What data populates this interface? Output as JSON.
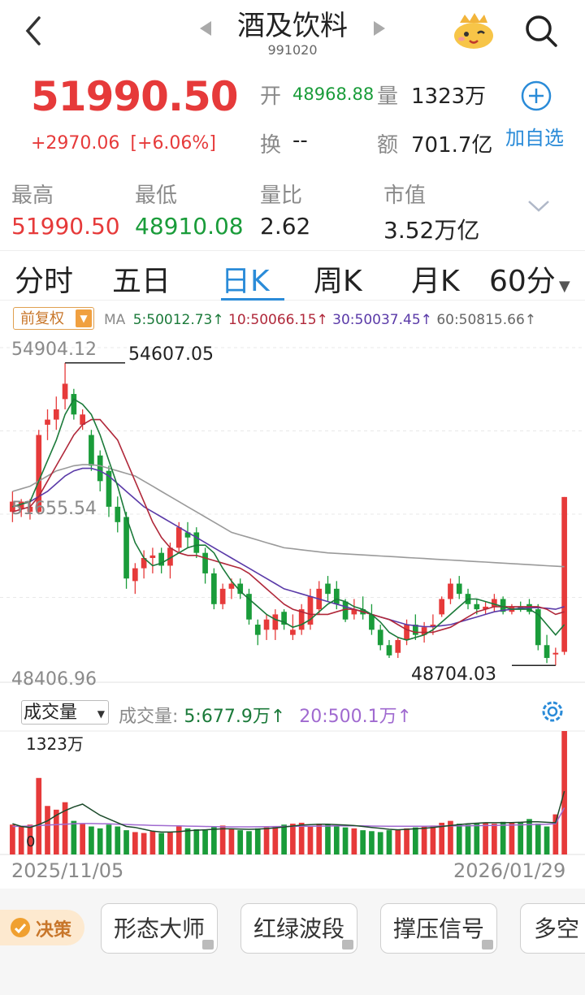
{
  "header": {
    "back_icon": "chevron-left-icon",
    "title": "酒及饮料",
    "code": "991020",
    "prev_icon": "triangle-left-icon",
    "next_icon": "triangle-right-icon",
    "mascot_icon": "mascot-icon",
    "search_icon": "search-icon"
  },
  "quote": {
    "price": "51990.50",
    "change": "+2970.06",
    "change_pct": "[+6.06%]",
    "open_label": "开",
    "open_value": "48968.88",
    "volume_label": "量",
    "volume_value": "1323万",
    "turnover_label": "换",
    "turnover_value": "--",
    "amount_label": "额",
    "amount_value": "701.7亿",
    "add_label": "加自选"
  },
  "stats": {
    "high_label": "最高",
    "high_value": "51990.50",
    "low_label": "最低",
    "low_value": "48910.08",
    "ratio_label": "量比",
    "ratio_value": "2.62",
    "cap_label": "市值",
    "cap_value": "3.52万亿"
  },
  "tabs": [
    "分时",
    "五日",
    "日K",
    "周K",
    "月K",
    "60分"
  ],
  "active_tab": "日K",
  "ma": {
    "fq_label": "前复权",
    "ma_label": "MA",
    "ma5": "5:50012.73",
    "ma10": "10:50066.15",
    "ma30": "30:50037.45",
    "ma60": "60:50815.66"
  },
  "colors": {
    "up": "#e63a3a",
    "down": "#1a9c3a",
    "ma5": "#1b7a3a",
    "ma10": "#b0283a",
    "ma30": "#5a3aa8",
    "ma60": "#9a9a9a",
    "accent": "#2a8bd8"
  },
  "chart_labels": {
    "top": "54904.12",
    "mid": "51655.54",
    "bottom": "48406.96",
    "max_marker": "54607.05",
    "min_marker": "48704.03",
    "date_start": "2025/11/05",
    "date_end": "2026/01/29"
  },
  "volume": {
    "select_label": "成交量",
    "label": "成交量:",
    "ma5": "5:677.9万",
    "ma20": "20:500.1万",
    "max_label": "1323万",
    "zero_label": "0",
    "settings_icon": "gear-icon"
  },
  "bottom_bar": {
    "decision_label": "决策",
    "buttons": [
      "形态大师",
      "红绿波段",
      "撑压信号",
      "多空"
    ]
  },
  "chart_data": {
    "type": "candlestick",
    "ylim": [
      48406.96,
      54904.12
    ],
    "candles": [
      {
        "o": 51900,
        "h": 52100,
        "l": 51500,
        "c": 51700,
        "up": true
      },
      {
        "o": 51750,
        "h": 51950,
        "l": 51600,
        "c": 51900,
        "up": true
      },
      {
        "o": 51700,
        "h": 51950,
        "l": 51550,
        "c": 51800,
        "up": true
      },
      {
        "o": 51700,
        "h": 53300,
        "l": 51650,
        "c": 53200,
        "up": true
      },
      {
        "o": 53400,
        "h": 53700,
        "l": 53100,
        "c": 53500,
        "up": true
      },
      {
        "o": 53500,
        "h": 53950,
        "l": 53300,
        "c": 53700,
        "up": true
      },
      {
        "o": 53900,
        "h": 54607,
        "l": 53700,
        "c": 54200,
        "up": true
      },
      {
        "o": 54000,
        "h": 54100,
        "l": 53500,
        "c": 53600,
        "up": false
      },
      {
        "o": 53600,
        "h": 53700,
        "l": 53300,
        "c": 53400,
        "up": true
      },
      {
        "o": 53200,
        "h": 53300,
        "l": 52500,
        "c": 52600,
        "up": false
      },
      {
        "o": 52800,
        "h": 52900,
        "l": 52100,
        "c": 52300,
        "up": false
      },
      {
        "o": 52500,
        "h": 52600,
        "l": 51600,
        "c": 51800,
        "up": false
      },
      {
        "o": 51800,
        "h": 52000,
        "l": 51300,
        "c": 51500,
        "up": false
      },
      {
        "o": 51600,
        "h": 51700,
        "l": 50200,
        "c": 50400,
        "up": false
      },
      {
        "o": 50350,
        "h": 50700,
        "l": 50100,
        "c": 50600,
        "up": true
      },
      {
        "o": 50600,
        "h": 50950,
        "l": 50400,
        "c": 50800,
        "up": true
      },
      {
        "o": 50800,
        "h": 51000,
        "l": 50500,
        "c": 50850,
        "up": true
      },
      {
        "o": 50900,
        "h": 51000,
        "l": 50500,
        "c": 50650,
        "up": false
      },
      {
        "o": 50650,
        "h": 51100,
        "l": 50400,
        "c": 51000,
        "up": true
      },
      {
        "o": 51000,
        "h": 51500,
        "l": 50900,
        "c": 51400,
        "up": true
      },
      {
        "o": 51300,
        "h": 51500,
        "l": 51000,
        "c": 51200,
        "up": false
      },
      {
        "o": 51300,
        "h": 51400,
        "l": 50800,
        "c": 50900,
        "up": false
      },
      {
        "o": 50900,
        "h": 51000,
        "l": 50300,
        "c": 50500,
        "up": false
      },
      {
        "o": 50500,
        "h": 50600,
        "l": 49800,
        "c": 49900,
        "up": false
      },
      {
        "o": 49900,
        "h": 50300,
        "l": 49800,
        "c": 50200,
        "up": true
      },
      {
        "o": 50200,
        "h": 50400,
        "l": 50000,
        "c": 50300,
        "up": true
      },
      {
        "o": 50300,
        "h": 50400,
        "l": 50000,
        "c": 50100,
        "up": false
      },
      {
        "o": 50100,
        "h": 50200,
        "l": 49500,
        "c": 49600,
        "up": false
      },
      {
        "o": 49500,
        "h": 49600,
        "l": 49100,
        "c": 49300,
        "up": false
      },
      {
        "o": 49400,
        "h": 49700,
        "l": 49200,
        "c": 49600,
        "up": true
      },
      {
        "o": 49400,
        "h": 49800,
        "l": 49200,
        "c": 49700,
        "up": true
      },
      {
        "o": 49750,
        "h": 49800,
        "l": 49400,
        "c": 49500,
        "up": false
      },
      {
        "o": 49400,
        "h": 49700,
        "l": 49200,
        "c": 49300,
        "up": true
      },
      {
        "o": 49400,
        "h": 49900,
        "l": 49300,
        "c": 49800,
        "up": true
      },
      {
        "o": 49500,
        "h": 50200,
        "l": 49400,
        "c": 50050,
        "up": true
      },
      {
        "o": 49800,
        "h": 50350,
        "l": 49700,
        "c": 50200,
        "up": true
      },
      {
        "o": 50300,
        "h": 50450,
        "l": 49950,
        "c": 50100,
        "up": false
      },
      {
        "o": 50200,
        "h": 50350,
        "l": 49800,
        "c": 49900,
        "up": false
      },
      {
        "o": 49950,
        "h": 50000,
        "l": 49550,
        "c": 49600,
        "up": false
      },
      {
        "o": 49700,
        "h": 50000,
        "l": 49600,
        "c": 49800,
        "up": true
      },
      {
        "o": 49800,
        "h": 50050,
        "l": 49600,
        "c": 49700,
        "up": false
      },
      {
        "o": 49700,
        "h": 49900,
        "l": 49300,
        "c": 49400,
        "up": false
      },
      {
        "o": 49400,
        "h": 49500,
        "l": 49000,
        "c": 49100,
        "up": false
      },
      {
        "o": 49100,
        "h": 49200,
        "l": 48850,
        "c": 48900,
        "up": false
      },
      {
        "o": 48950,
        "h": 49250,
        "l": 48850,
        "c": 49200,
        "up": true
      },
      {
        "o": 49200,
        "h": 49600,
        "l": 49100,
        "c": 49500,
        "up": true
      },
      {
        "o": 49500,
        "h": 49700,
        "l": 49200,
        "c": 49300,
        "up": false
      },
      {
        "o": 49300,
        "h": 49550,
        "l": 49150,
        "c": 49450,
        "up": true
      },
      {
        "o": 49450,
        "h": 49700,
        "l": 49300,
        "c": 49500,
        "up": true
      },
      {
        "o": 49700,
        "h": 50050,
        "l": 49650,
        "c": 50000,
        "up": true
      },
      {
        "o": 50000,
        "h": 50400,
        "l": 49900,
        "c": 50300,
        "up": true
      },
      {
        "o": 50300,
        "h": 50450,
        "l": 50000,
        "c": 50100,
        "up": false
      },
      {
        "o": 50100,
        "h": 50200,
        "l": 49800,
        "c": 49900,
        "up": false
      },
      {
        "o": 49900,
        "h": 50000,
        "l": 49700,
        "c": 49800,
        "up": false
      },
      {
        "o": 49800,
        "h": 49950,
        "l": 49700,
        "c": 49850,
        "up": true
      },
      {
        "o": 49850,
        "h": 50100,
        "l": 49750,
        "c": 50000,
        "up": true
      },
      {
        "o": 50000,
        "h": 50050,
        "l": 49700,
        "c": 49750,
        "up": false
      },
      {
        "o": 49750,
        "h": 49900,
        "l": 49700,
        "c": 49850,
        "up": true
      },
      {
        "o": 49850,
        "h": 49950,
        "l": 49750,
        "c": 49800,
        "up": false
      },
      {
        "o": 49900,
        "h": 50000,
        "l": 49700,
        "c": 49750,
        "up": false
      },
      {
        "o": 49800,
        "h": 49900,
        "l": 49000,
        "c": 49100,
        "up": false
      },
      {
        "o": 49100,
        "h": 49300,
        "l": 48750,
        "c": 48850,
        "up": false
      },
      {
        "o": 48950,
        "h": 49050,
        "l": 48704,
        "c": 48950,
        "up": true
      },
      {
        "o": 48968.88,
        "h": 51990.5,
        "l": 48910.08,
        "c": 51990.5,
        "up": true
      }
    ],
    "ma5": [
      51800,
      51850,
      51900,
      52300,
      52700,
      53100,
      53600,
      53900,
      53800,
      53600,
      53200,
      52700,
      52200,
      51600,
      51100,
      50800,
      50650,
      50700,
      50800,
      50900,
      51000,
      51050,
      51050,
      50900,
      50600,
      50350,
      50150,
      50000,
      49850,
      49700,
      49600,
      49550,
      49450,
      49500,
      49600,
      49750,
      49900,
      50000,
      49950,
      49850,
      49800,
      49700,
      49550,
      49350,
      49250,
      49200,
      49250,
      49300,
      49400,
      49550,
      49700,
      49850,
      50000,
      50000,
      49950,
      49900,
      49850,
      49800,
      49800,
      49800,
      49700,
      49500,
      49300,
      49500
    ],
    "ma10": [
      51700,
      51750,
      51800,
      52000,
      52300,
      52600,
      52900,
      53200,
      53400,
      53500,
      53500,
      53300,
      53100,
      52700,
      52300,
      51900,
      51500,
      51200,
      51000,
      50900,
      50850,
      50850,
      50800,
      50750,
      50700,
      50650,
      50600,
      50500,
      50350,
      50200,
      50050,
      49900,
      49800,
      49750,
      49700,
      49700,
      49700,
      49750,
      49800,
      49800,
      49750,
      49700,
      49650,
      49600,
      49500,
      49400,
      49350,
      49350,
      49350,
      49400,
      49450,
      49550,
      49650,
      49750,
      49800,
      49850,
      49850,
      49850,
      49850,
      49850,
      49850,
      49800,
      49700,
      49750
    ],
    "ma30": [
      51800,
      51850,
      51900,
      52000,
      52100,
      52250,
      52400,
      52500,
      52550,
      52550,
      52500,
      52400,
      52250,
      52100,
      51950,
      51800,
      51700,
      51600,
      51500,
      51400,
      51300,
      51200,
      51100,
      51000,
      50900,
      50800,
      50700,
      50600,
      50500,
      50400,
      50300,
      50200,
      50150,
      50100,
      50050,
      50000,
      49950,
      49900,
      49850,
      49800,
      49750,
      49700,
      49650,
      49600,
      49550,
      49500,
      49480,
      49460,
      49460,
      49480,
      49500,
      49550,
      49600,
      49650,
      49700,
      49750,
      49780,
      49800,
      49820,
      49830,
      49830,
      49820,
      49800,
      49850
    ],
    "ma60": [
      52100,
      52150,
      52200,
      52300,
      52400,
      52500,
      52550,
      52600,
      52620,
      52620,
      52600,
      52550,
      52500,
      52450,
      52400,
      52300,
      52200,
      52100,
      52000,
      51900,
      51800,
      51700,
      51600,
      51500,
      51400,
      51300,
      51250,
      51200,
      51150,
      51100,
      51050,
      51000,
      50980,
      50960,
      50940,
      50920,
      50900,
      50890,
      50880,
      50870,
      50860,
      50850,
      50840,
      50830,
      50820,
      50810,
      50800,
      50790,
      50780,
      50770,
      50760,
      50750,
      50740,
      50730,
      50720,
      50710,
      50700,
      50690,
      50680,
      50670,
      50660,
      50650,
      50640,
      50630
    ],
    "volume": [
      320,
      300,
      320,
      820,
      520,
      480,
      560,
      360,
      330,
      300,
      280,
      320,
      300,
      260,
      240,
      230,
      250,
      230,
      240,
      300,
      280,
      270,
      260,
      300,
      310,
      270,
      260,
      250,
      280,
      290,
      300,
      320,
      330,
      340,
      300,
      330,
      320,
      310,
      290,
      280,
      260,
      250,
      240,
      260,
      270,
      280,
      290,
      300,
      310,
      340,
      360,
      330,
      320,
      330,
      340,
      330,
      350,
      340,
      350,
      380,
      330,
      300,
      430,
      1323
    ],
    "vol_ma5": [
      330,
      300,
      290,
      320,
      360,
      420,
      470,
      510,
      540,
      480,
      420,
      380,
      340,
      300,
      290,
      270,
      250,
      240,
      240,
      245,
      255,
      260,
      265,
      270,
      275,
      275,
      272,
      270,
      272,
      278,
      285,
      295,
      305,
      315,
      320,
      325,
      325,
      320,
      315,
      310,
      300,
      290,
      280,
      270,
      265,
      270,
      275,
      280,
      290,
      300,
      310,
      320,
      330,
      335,
      340,
      340,
      340,
      342,
      345,
      350,
      350,
      345,
      340,
      677.9
    ],
    "vol_ma20": [
      300,
      302,
      305,
      310,
      315,
      320,
      325,
      330,
      332,
      332,
      330,
      328,
      325,
      322,
      318,
      315,
      312,
      310,
      308,
      306,
      304,
      302,
      300,
      298,
      297,
      296,
      296,
      296,
      297,
      298,
      299,
      300,
      301,
      302,
      303,
      304,
      305,
      306,
      306,
      306,
      306,
      305,
      304,
      303,
      302,
      302,
      302,
      303,
      304,
      305,
      306,
      307,
      308,
      309,
      310,
      312,
      314,
      316,
      318,
      320,
      322,
      325,
      330,
      500.1
    ],
    "vol_max": 1323
  }
}
